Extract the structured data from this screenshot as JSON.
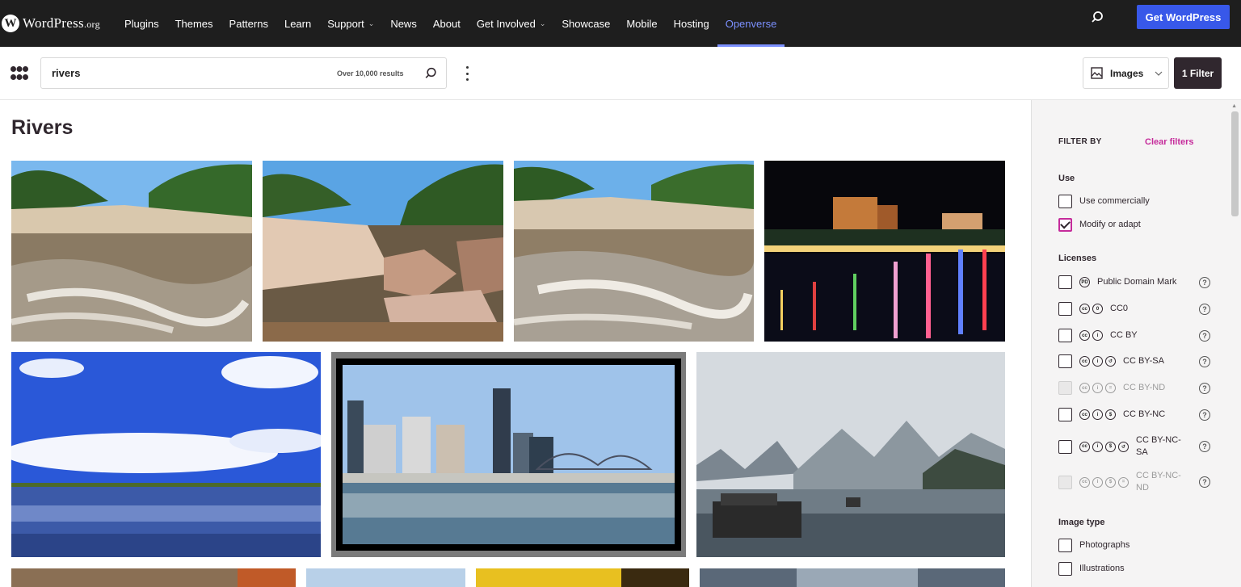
{
  "wp_nav": {
    "logo_main": "WordPress",
    "logo_suffix": ".org",
    "items": [
      {
        "label": "Plugins",
        "dropdown": false
      },
      {
        "label": "Themes",
        "dropdown": false
      },
      {
        "label": "Patterns",
        "dropdown": false
      },
      {
        "label": "Learn",
        "dropdown": false
      },
      {
        "label": "Support",
        "dropdown": true
      },
      {
        "label": "News",
        "dropdown": false
      },
      {
        "label": "About",
        "dropdown": false
      },
      {
        "label": "Get Involved",
        "dropdown": true
      },
      {
        "label": "Showcase",
        "dropdown": false
      },
      {
        "label": "Mobile",
        "dropdown": false
      },
      {
        "label": "Hosting",
        "dropdown": false
      },
      {
        "label": "Openverse",
        "dropdown": false,
        "active": true
      }
    ],
    "cta": "Get WordPress"
  },
  "search": {
    "query": "rivers",
    "result_count": "Over 10,000 results"
  },
  "content_type": {
    "selected": "Images"
  },
  "filter_button": "1 Filter",
  "page_title": "Rivers",
  "images": [
    {
      "subject": "river with rocks and trees under blue sky"
    },
    {
      "subject": "large rocks in rapids"
    },
    {
      "subject": "river with foam and rocky banks"
    },
    {
      "subject": "city river at night with colored reflections"
    },
    {
      "subject": "wide river under clouds"
    },
    {
      "subject": "city skyline and bridge over river"
    },
    {
      "subject": "karst mountains and boats in mist"
    }
  ],
  "sidebar": {
    "filter_by": "FILTER BY",
    "clear": "Clear filters",
    "use_title": "Use",
    "use_options": [
      {
        "label": "Use commercially",
        "checked": false
      },
      {
        "label": "Modify or adapt",
        "checked": true
      }
    ],
    "licenses_title": "Licenses",
    "licenses": [
      {
        "label": "Public Domain Mark",
        "icons": [
          "pd"
        ],
        "disabled": false
      },
      {
        "label": "CC0",
        "icons": [
          "cc",
          "zero"
        ],
        "disabled": false
      },
      {
        "label": "CC BY",
        "icons": [
          "cc",
          "by"
        ],
        "disabled": false
      },
      {
        "label": "CC BY-SA",
        "icons": [
          "cc",
          "by",
          "sa"
        ],
        "disabled": false
      },
      {
        "label": "CC BY-ND",
        "icons": [
          "cc",
          "by",
          "nd"
        ],
        "disabled": true
      },
      {
        "label": "CC BY-NC",
        "icons": [
          "cc",
          "by",
          "nc"
        ],
        "disabled": false
      },
      {
        "label": "CC BY-NC-SA",
        "icons": [
          "cc",
          "by",
          "nc",
          "sa"
        ],
        "disabled": false
      },
      {
        "label": "CC BY-NC-ND",
        "icons": [
          "cc",
          "by",
          "nc",
          "nd"
        ],
        "disabled": true
      }
    ],
    "image_type_title": "Image type",
    "image_types": [
      {
        "label": "Photographs",
        "checked": false
      },
      {
        "label": "Illustrations",
        "checked": false
      }
    ]
  }
}
